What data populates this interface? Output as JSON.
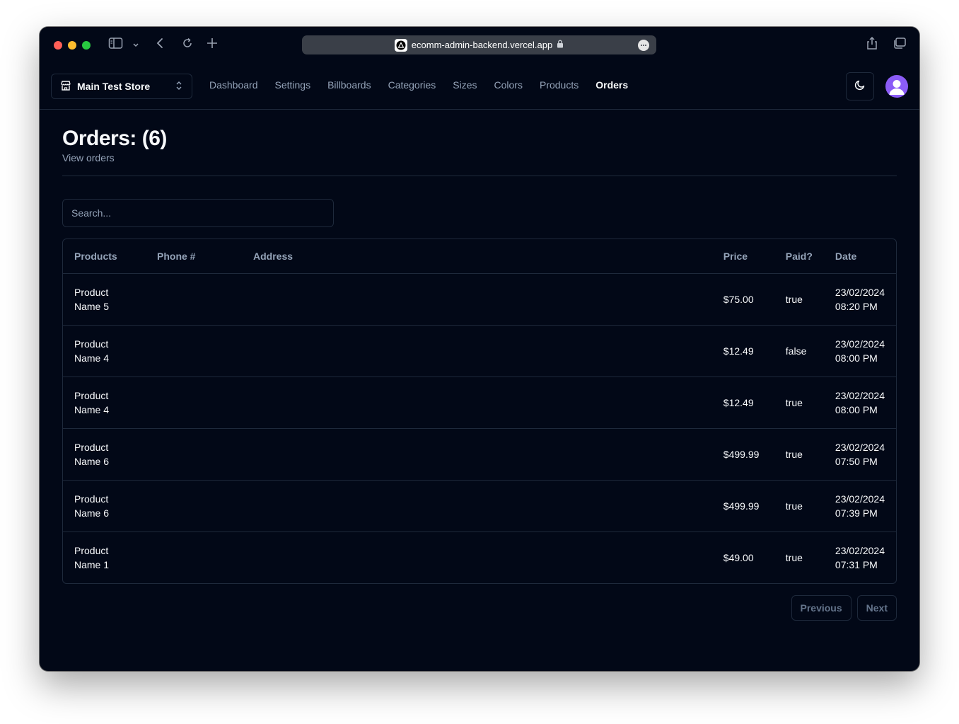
{
  "browser": {
    "url": "ecomm-admin-backend.vercel.app"
  },
  "navbar": {
    "store_name": "Main Test Store",
    "links": [
      {
        "label": "Dashboard",
        "active": false
      },
      {
        "label": "Settings",
        "active": false
      },
      {
        "label": "Billboards",
        "active": false
      },
      {
        "label": "Categories",
        "active": false
      },
      {
        "label": "Sizes",
        "active": false
      },
      {
        "label": "Colors",
        "active": false
      },
      {
        "label": "Products",
        "active": false
      },
      {
        "label": "Orders",
        "active": true
      }
    ]
  },
  "page": {
    "title": "Orders: (6)",
    "description": "View orders"
  },
  "search": {
    "placeholder": "Search..."
  },
  "table": {
    "headers": {
      "products": "Products",
      "phone": "Phone #",
      "address": "Address",
      "price": "Price",
      "paid": "Paid?",
      "date": "Date"
    },
    "rows": [
      {
        "product_line1": "Product",
        "product_line2": "Name 5",
        "phone": "",
        "address": "",
        "price": "$75.00",
        "paid": "true",
        "date": "23/02/2024",
        "time": "08:20 PM"
      },
      {
        "product_line1": "Product",
        "product_line2": "Name 4",
        "phone": "",
        "address": "",
        "price": "$12.49",
        "paid": "false",
        "date": "23/02/2024",
        "time": "08:00 PM"
      },
      {
        "product_line1": "Product",
        "product_line2": "Name 4",
        "phone": "",
        "address": "",
        "price": "$12.49",
        "paid": "true",
        "date": "23/02/2024",
        "time": "08:00 PM"
      },
      {
        "product_line1": "Product",
        "product_line2": "Name 6",
        "phone": "",
        "address": "",
        "price": "$499.99",
        "paid": "true",
        "date": "23/02/2024",
        "time": "07:50 PM"
      },
      {
        "product_line1": "Product",
        "product_line2": "Name 6",
        "phone": "",
        "address": "",
        "price": "$499.99",
        "paid": "true",
        "date": "23/02/2024",
        "time": "07:39 PM"
      },
      {
        "product_line1": "Product",
        "product_line2": "Name 1",
        "phone": "",
        "address": "",
        "price": "$49.00",
        "paid": "true",
        "date": "23/02/2024",
        "time": "07:31 PM"
      }
    ]
  },
  "pagination": {
    "previous_label": "Previous",
    "next_label": "Next"
  },
  "colors": {
    "background": "#020817",
    "border": "#1e293b",
    "text": "#f8fafc",
    "muted": "#94a3b8",
    "avatar": "#8b5cf6"
  }
}
